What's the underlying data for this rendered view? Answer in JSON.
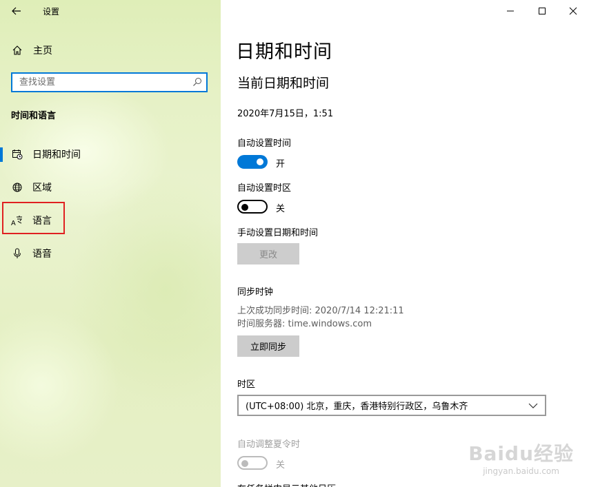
{
  "window": {
    "title": "设置",
    "controls": [
      "minimize-icon",
      "maximize-icon",
      "close-icon"
    ]
  },
  "sidebar": {
    "home_label": "主页",
    "search_placeholder": "查找设置",
    "section_title": "时间和语言",
    "items": [
      {
        "label": "日期和时间",
        "icon": "calendar-clock-icon",
        "active": true
      },
      {
        "label": "区域",
        "icon": "globe-icon",
        "active": false
      },
      {
        "label": "语言",
        "icon": "language-icon",
        "active": false,
        "highlighted": true
      },
      {
        "label": "语音",
        "icon": "microphone-icon",
        "active": false
      }
    ]
  },
  "main": {
    "title": "日期和时间",
    "subtitle": "当前日期和时间",
    "current_datetime": "2020年7月15日，1:51",
    "auto_time": {
      "label": "自动设置时间",
      "state": "开",
      "on": true
    },
    "auto_timezone": {
      "label": "自动设置时区",
      "state": "关",
      "on": false
    },
    "manual": {
      "label": "手动设置日期和时间",
      "button": "更改"
    },
    "sync": {
      "title": "同步时钟",
      "last_sync": "上次成功同步时间: 2020/7/14 12:21:11",
      "server": "时间服务器: time.windows.com",
      "button": "立即同步"
    },
    "timezone": {
      "label": "时区",
      "selected": "(UTC+08:00) 北京，重庆，香港特别行政区，乌鲁木齐"
    },
    "dst": {
      "label": "自动调整夏令时",
      "state": "关",
      "on": false,
      "disabled": true
    },
    "more_calendars_label": "在任务栏中显示其他日历"
  },
  "watermark": {
    "logo": "Baidu经验",
    "url": "jingyan.baidu.com"
  },
  "colors": {
    "accent": "#0078d7",
    "highlight": "#e02020"
  }
}
